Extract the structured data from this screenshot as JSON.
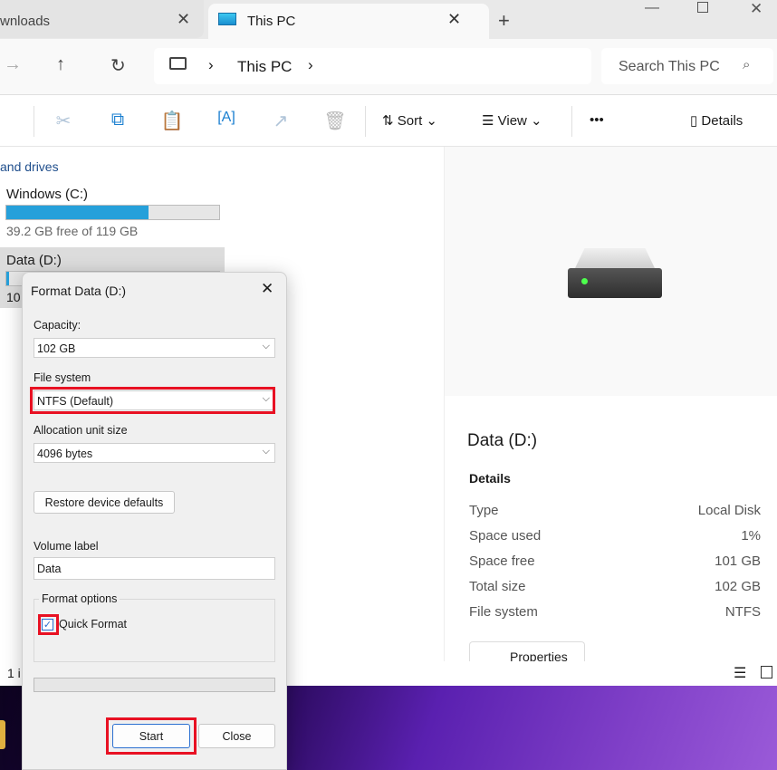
{
  "tabs": [
    {
      "label": "wnloads",
      "icon": "folder-icon"
    },
    {
      "label": "This PC",
      "icon": "monitor-icon"
    }
  ],
  "address": {
    "crumb": "This PC",
    "search_placeholder": "Search This PC"
  },
  "toolbar": {
    "sort": "Sort",
    "view": "View",
    "more": "•••",
    "details": "Details"
  },
  "section": "and drives",
  "drives": [
    {
      "name": "Windows (C:)",
      "free_text": "39.2 GB free of 119 GB",
      "used_percent": 67
    },
    {
      "name": "Data (D:)",
      "free_text": "10",
      "used_percent": 1
    }
  ],
  "status": "1 i",
  "details_pane": {
    "title": "Data (D:)",
    "heading": "Details",
    "rows": [
      {
        "k": "Type",
        "v": "Local Disk"
      },
      {
        "k": "Space used",
        "v": "1%"
      },
      {
        "k": "Space free",
        "v": "101 GB"
      },
      {
        "k": "Total size",
        "v": "102 GB"
      },
      {
        "k": "File system",
        "v": "NTFS"
      }
    ],
    "properties": "Properties"
  },
  "dialog": {
    "title": "Format Data (D:)",
    "capacity_label": "Capacity:",
    "capacity": "102 GB",
    "fs_label": "File system",
    "fs": "NTFS (Default)",
    "alloc_label": "Allocation unit size",
    "alloc": "4096 bytes",
    "restore": "Restore device defaults",
    "vol_label": "Volume label",
    "vol": "Data",
    "options_label": "Format options",
    "quick": "Quick Format",
    "quick_checked": true,
    "progress": 0,
    "start": "Start",
    "close": "Close"
  },
  "colors": {
    "accent": "#26a0da",
    "highlight": "#e81123"
  }
}
